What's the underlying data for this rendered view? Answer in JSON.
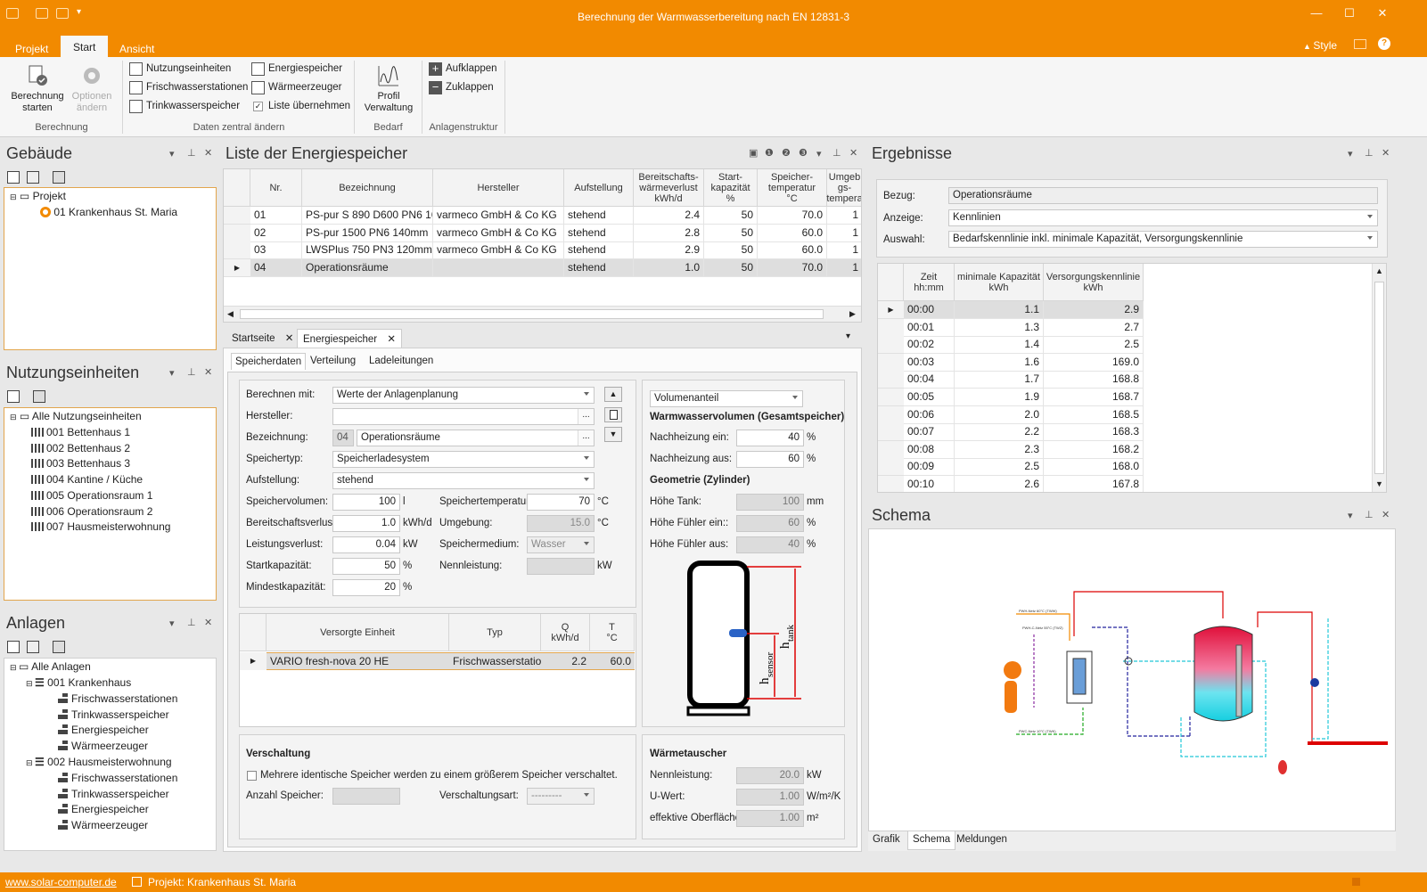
{
  "window": {
    "title": "Berechnung der Warmwasserbereitung nach EN 12831-3"
  },
  "menu": {
    "tabs": [
      "Projekt",
      "Start",
      "Ansicht"
    ],
    "style_label": "Style"
  },
  "ribbon": {
    "berechnung_starten": "Berechnung starten",
    "optionen_aendern": "Optionen ändern",
    "group_berechnung": "Berechnung",
    "nutzungseinheiten": "Nutzungseinheiten",
    "frischwasserstationen": "Frischwasserstationen",
    "trinkwasserspeicher": "Trinkwasserspeicher",
    "energiespeicher": "Energiespeicher",
    "waermeerzeuger": "Wärmeerzeuger",
    "liste_uebernehmen": "Liste übernehmen",
    "group_daten": "Daten zentral ändern",
    "profil_verwaltung": "Profil Verwaltung",
    "group_bedarf": "Bedarf",
    "aufklappen": "Aufklappen",
    "zuklappen": "Zuklappen",
    "group_anlagen": "Anlagenstruktur"
  },
  "gebaeude": {
    "title": "Gebäude",
    "root": "Projekt",
    "item": "01 Krankenhaus St. Maria"
  },
  "nutzung": {
    "title": "Nutzungseinheiten",
    "root": "Alle Nutzungseinheiten",
    "items": [
      "001 Bettenhaus 1",
      "002 Bettenhaus 2",
      "003 Bettenhaus 3",
      "004 Kantine / Küche",
      "005 Operationsraum 1",
      "006 Operationsraum 2",
      "007 Hausmeisterwohnung"
    ]
  },
  "anlagen": {
    "title": "Anlagen",
    "root": "Alle Anlagen",
    "g1": "001 Krankenhaus",
    "g1items": [
      "Frischwasserstationen",
      "Trinkwasserspeicher",
      "Energiespeicher",
      "Wärmeerzeuger"
    ],
    "g2": "002 Hausmeisterwohnung",
    "g2items": [
      "Frischwasserstationen",
      "Trinkwasserspeicher",
      "Energiespeicher",
      "Wärmeerzeuger"
    ]
  },
  "liste": {
    "title": "Liste der Energiespeicher",
    "headers": [
      "Nr.",
      "Bezeichnung",
      "Hersteller",
      "Aufstellung",
      "Bereitschafts-\nwärmeverlust\nkWh/d",
      "Start-\nkapazität\n%",
      "Speicher-\ntemperatur\n°C",
      "Umgeb\ngs-\ntempera"
    ],
    "rows": [
      [
        "01",
        "PS-pur S 890 D600 PN6 16...",
        "varmeco GmbH & Co KG",
        "stehend",
        "2.4",
        "50",
        "70.0",
        "1"
      ],
      [
        "02",
        "PS-pur 1500 PN6 140mm",
        "varmeco GmbH & Co KG",
        "stehend",
        "2.8",
        "50",
        "60.0",
        "1"
      ],
      [
        "03",
        "LWSPlus 750 PN3 120mm ...",
        "varmeco GmbH & Co KG",
        "stehend",
        "2.9",
        "50",
        "60.0",
        "1"
      ],
      [
        "04",
        "Operationsräume",
        "",
        "stehend",
        "1.0",
        "50",
        "70.0",
        "1"
      ]
    ]
  },
  "doctabs": [
    "Startseite",
    "Energiespeicher"
  ],
  "subtabs": [
    "Speicherdaten",
    "Verteilung",
    "Ladeleitungen"
  ],
  "form": {
    "berechnen_mit": "Berechnen mit:",
    "berechnen_mit_val": "Werte der Anlagenplanung",
    "hersteller": "Hersteller:",
    "hersteller_val": "",
    "bezeichnung": "Bezeichnung:",
    "bez_nr": "04",
    "bez_val": "Operationsräume",
    "speichertyp": "Speichertyp:",
    "speichertyp_val": "Speicherladesystem",
    "aufstellung": "Aufstellung:",
    "aufstellung_val": "stehend",
    "speichervolumen": "Speichervolumen:",
    "speichervolumen_val": "100",
    "speichervolumen_unit": "l",
    "bereitschaftsverlust": "Bereitschaftsverlust:",
    "bereitschaftsverlust_val": "1.0",
    "bereitschaftsverlust_unit": "kWh/d",
    "leistungsverlust": "Leistungsverlust:",
    "leistungsverlust_val": "0.04",
    "leistungsverlust_unit": "kW",
    "startkapazitaet": "Startkapazität:",
    "startkapazitaet_val": "50",
    "pct": "%",
    "mindestkapazitaet": "Mindestkapazität:",
    "mindestkapazitaet_val": "20",
    "speichertemperatur": "Speichertemperatur:",
    "speichertemperatur_val": "70",
    "degc": "°C",
    "umgebung": "Umgebung:",
    "umgebung_val": "15.0",
    "speichermedium": "Speichermedium:",
    "speichermedium_val": "Wasser",
    "nennleistung": "Nennleistung:",
    "nennleistung_val": "",
    "kw": "kW"
  },
  "versorgt": {
    "headers": [
      "Versorgte Einheit",
      "Typ",
      "Q\nkWh/d",
      "T\n°C"
    ],
    "row": [
      "VARIO fresh-nova 20 HE",
      "Frischwasserstation",
      "2.2",
      "60.0"
    ]
  },
  "vol": {
    "select": "Volumenanteil",
    "title": "Warmwasservolumen (Gesamtspeicher)",
    "nach_ein": "Nachheizung ein:",
    "nach_ein_val": "40",
    "nach_aus": "Nachheizung aus:",
    "nach_aus_val": "60",
    "geo_title": "Geometrie (Zylinder)",
    "hoehe_tank": "Höhe Tank:",
    "hoehe_tank_val": "100",
    "mm": "mm",
    "fuehler_ein": "Höhe Fühler ein::",
    "fuehler_ein_val": "60",
    "fuehler_aus": "Höhe Fühler aus:",
    "fuehler_aus_val": "40",
    "h_sensor": "h",
    "h_sensor_sub": "sensor",
    "h_tank": "h",
    "h_tank_sub": "tank"
  },
  "verschaltung": {
    "title": "Verschaltung",
    "check": "Mehrere identische Speicher werden zu einem größerem Speicher verschaltet.",
    "anzahl": "Anzahl Speicher:",
    "art": "Verschaltungsart:",
    "art_val": "---------"
  },
  "waermetauscher": {
    "title": "Wärmetauscher",
    "nennleistung": "Nennleistung:",
    "nennleistung_val": "20.0",
    "kw": "kW",
    "uwert": "U-Wert:",
    "uwert_val": "1.00",
    "uwert_unit": "W/m²/K",
    "ober": "effektive Oberfläche:",
    "ober_val": "1.00",
    "m2": "m²"
  },
  "ergebnisse": {
    "title": "Ergebnisse",
    "bezug": "Bezug:",
    "bezug_val": "Operationsräume",
    "anzeige": "Anzeige:",
    "anzeige_val": "Kennlinien",
    "auswahl": "Auswahl:",
    "auswahl_val": "Bedarfskennlinie inkl. minimale Kapazität, Versorgungskennlinie",
    "headers": [
      "Zeit\nhh:mm",
      "minimale Kapazität\nkWh",
      "Versorgungskennlinie\nkWh"
    ],
    "rows": [
      [
        "00:00",
        "1.1",
        "2.9"
      ],
      [
        "00:01",
        "1.3",
        "2.7"
      ],
      [
        "00:02",
        "1.4",
        "2.5"
      ],
      [
        "00:03",
        "1.6",
        "169.0"
      ],
      [
        "00:04",
        "1.7",
        "168.8"
      ],
      [
        "00:05",
        "1.9",
        "168.7"
      ],
      [
        "00:06",
        "2.0",
        "168.5"
      ],
      [
        "00:07",
        "2.2",
        "168.3"
      ],
      [
        "00:08",
        "2.3",
        "168.2"
      ],
      [
        "00:09",
        "2.5",
        "168.0"
      ],
      [
        "00:10",
        "2.6",
        "167.8"
      ]
    ]
  },
  "schema": {
    "title": "Schema",
    "tabs": [
      "Grafik",
      "Schema",
      "Meldungen"
    ],
    "lbl1": "PWH-Netz 60°C (TWW)",
    "lbl2": "PWH-C-Netz 55°C (TWZ)",
    "lbl3": "PWC-Netz 10°C (TWK)"
  },
  "status": {
    "link": "www.solar-computer.de",
    "project": "Projekt: Krankenhaus St. Maria"
  }
}
